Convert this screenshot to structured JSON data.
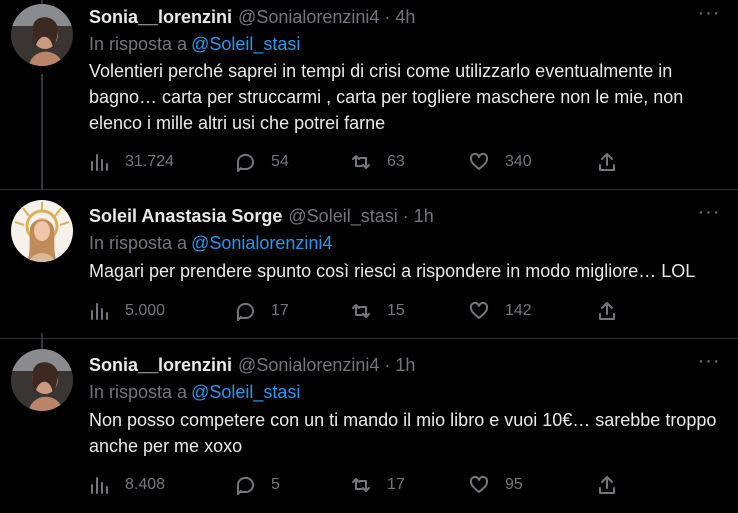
{
  "tweets": [
    {
      "name": "Sonia__lorenzini",
      "handle": "@Sonialorenzini4",
      "time": "4h",
      "reply_prefix": "In risposta a",
      "reply_to": "@Soleil_stasi",
      "text": "Volentieri perché saprei in tempi di crisi come utilizzarlo eventualmente in bagno… carta per struccarmi , carta per togliere maschere non le mie, non elenco i mille altri usi che potrei farne",
      "views": "31.724",
      "replies": "54",
      "retweets": "63",
      "likes": "340"
    },
    {
      "name": "Soleil Anastasia Sorge",
      "handle": "@Soleil_stasi",
      "time": "1h",
      "reply_prefix": "In risposta a",
      "reply_to": "@Sonialorenzini4",
      "text": "Magari per prendere spunto così riesci a rispondere in modo migliore… LOL",
      "views": "5.000",
      "replies": "17",
      "retweets": "15",
      "likes": "142"
    },
    {
      "name": "Sonia__lorenzini",
      "handle": "@Sonialorenzini4",
      "time": "1h",
      "reply_prefix": "In risposta a",
      "reply_to": "@Soleil_stasi",
      "text": "Non posso competere con un ti mando il mio libro e vuoi 10€… sarebbe troppo anche per me xoxo",
      "views": "8.408",
      "replies": "5",
      "retweets": "17",
      "likes": "95"
    }
  ],
  "icons": {
    "views": "analytics-icon",
    "replies": "reply-icon",
    "retweets": "retweet-icon",
    "likes": "heart-icon",
    "share": "share-icon",
    "more": "more-icon"
  },
  "colors": {
    "background": "#000000",
    "text": "#e7e9ea",
    "secondary": "#71767b",
    "link": "#1d9bf0",
    "divider": "#2f3336"
  }
}
